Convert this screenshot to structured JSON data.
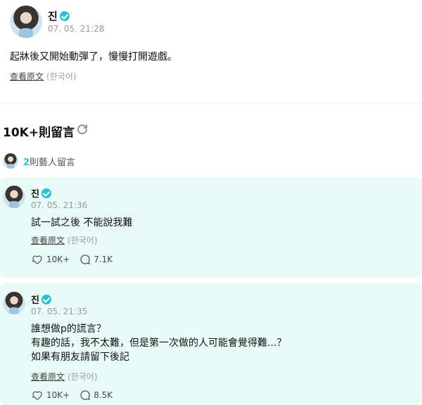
{
  "post": {
    "author": "진",
    "timestamp": "07. 05. 21:28",
    "body": "起牀後又開始動彈了，慢慢打開遊戲。",
    "translate_label": "查看原文",
    "source_language": "(한국어)"
  },
  "comments_section": {
    "title": "10K+則留言",
    "artist_count": "2",
    "artist_label": "則藝人留言"
  },
  "comments": [
    {
      "author": "진",
      "timestamp": "07. 05. 21:36",
      "lines": [
        "試一試之後 不能說我難"
      ],
      "translate_label": "查看原文",
      "source_language": "(한국어)",
      "likes": "10K+",
      "replies": "7.1K"
    },
    {
      "author": "진",
      "timestamp": "07. 05. 21:35",
      "lines": [
        "誰想做p的謊言？",
        "有趣的話，我不太難，但是第一次做的人可能會覺得難...？",
        "如果有朋友請留下後記"
      ],
      "translate_label": "查看原文",
      "source_language": "(한국어)",
      "likes": "10K+",
      "replies": "8.5K"
    }
  ],
  "colors": {
    "accent": "#2bbfd6",
    "comment_background": "#e9fbf6"
  },
  "icons": [
    "verified-icon",
    "refresh-icon",
    "like-icon",
    "reply-icon"
  ]
}
